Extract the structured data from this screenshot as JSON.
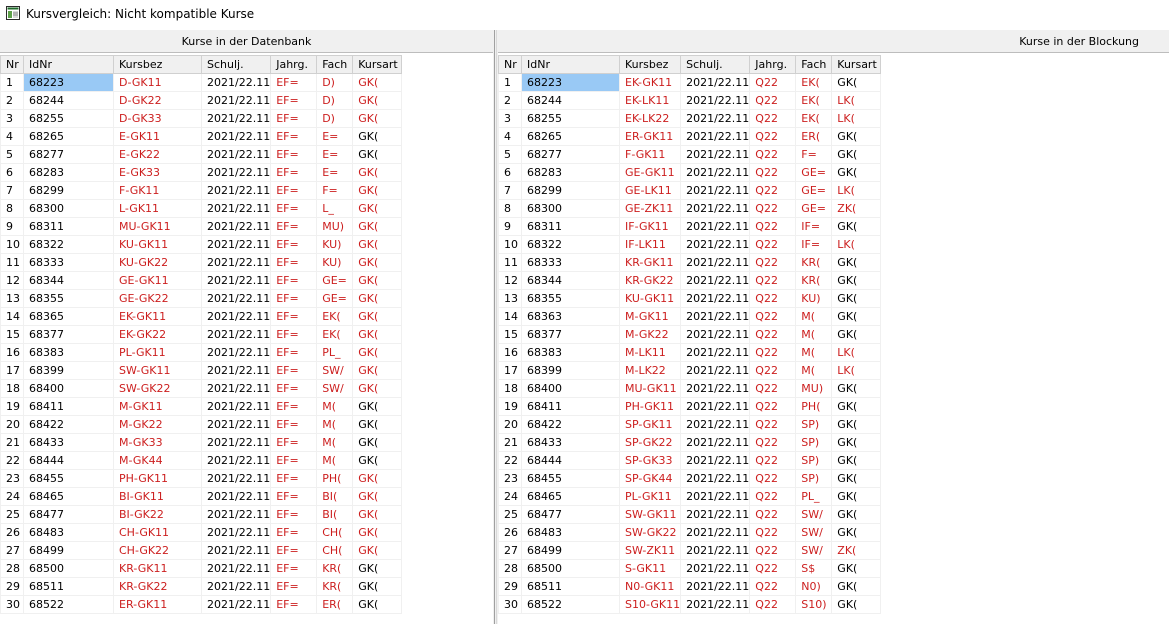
{
  "window": {
    "title": "Kursvergleich: Nicht kompatible Kurse",
    "icon": "app-window-icon"
  },
  "colors": {
    "mismatch": "#cc1e1e",
    "selection": "#99c9f5",
    "header_bg": "#f0f0f0"
  },
  "left": {
    "header": "Kurse in der Datenbank",
    "columns": [
      "Nr",
      "IdNr",
      "Kursbez",
      "Schulj.",
      "Jahrg.",
      "Fach",
      "Kursart"
    ],
    "rows": [
      [
        "1",
        "68223",
        "D-GK11",
        "2021/22.11",
        "EF=",
        "D)",
        "GK("
      ],
      [
        "2",
        "68244",
        "D-GK22",
        "2021/22.11",
        "EF=",
        "D)",
        "GK("
      ],
      [
        "3",
        "68255",
        "D-GK33",
        "2021/22.11",
        "EF=",
        "D)",
        "GK("
      ],
      [
        "4",
        "68265",
        "E-GK11",
        "2021/22.11",
        "EF=",
        "E=",
        "GK("
      ],
      [
        "5",
        "68277",
        "E-GK22",
        "2021/22.11",
        "EF=",
        "E=",
        "GK("
      ],
      [
        "6",
        "68283",
        "E-GK33",
        "2021/22.11",
        "EF=",
        "E=",
        "GK("
      ],
      [
        "7",
        "68299",
        "F-GK11",
        "2021/22.11",
        "EF=",
        "F=",
        "GK("
      ],
      [
        "8",
        "68300",
        "L-GK11",
        "2021/22.11",
        "EF=",
        "L_",
        "GK("
      ],
      [
        "9",
        "68311",
        "MU-GK11",
        "2021/22.11",
        "EF=",
        "MU)",
        "GK("
      ],
      [
        "10",
        "68322",
        "KU-GK11",
        "2021/22.11",
        "EF=",
        "KU)",
        "GK("
      ],
      [
        "11",
        "68333",
        "KU-GK22",
        "2021/22.11",
        "EF=",
        "KU)",
        "GK("
      ],
      [
        "12",
        "68344",
        "GE-GK11",
        "2021/22.11",
        "EF=",
        "GE=",
        "GK("
      ],
      [
        "13",
        "68355",
        "GE-GK22",
        "2021/22.11",
        "EF=",
        "GE=",
        "GK("
      ],
      [
        "14",
        "68365",
        "EK-GK11",
        "2021/22.11",
        "EF=",
        "EK(",
        "GK("
      ],
      [
        "15",
        "68377",
        "EK-GK22",
        "2021/22.11",
        "EF=",
        "EK(",
        "GK("
      ],
      [
        "16",
        "68383",
        "PL-GK11",
        "2021/22.11",
        "EF=",
        "PL_",
        "GK("
      ],
      [
        "17",
        "68399",
        "SW-GK11",
        "2021/22.11",
        "EF=",
        "SW/",
        "GK("
      ],
      [
        "18",
        "68400",
        "SW-GK22",
        "2021/22.11",
        "EF=",
        "SW/",
        "GK("
      ],
      [
        "19",
        "68411",
        "M-GK11",
        "2021/22.11",
        "EF=",
        "M(",
        "GK("
      ],
      [
        "20",
        "68422",
        "M-GK22",
        "2021/22.11",
        "EF=",
        "M(",
        "GK("
      ],
      [
        "21",
        "68433",
        "M-GK33",
        "2021/22.11",
        "EF=",
        "M(",
        "GK("
      ],
      [
        "22",
        "68444",
        "M-GK44",
        "2021/22.11",
        "EF=",
        "M(",
        "GK("
      ],
      [
        "23",
        "68455",
        "PH-GK11",
        "2021/22.11",
        "EF=",
        "PH(",
        "GK("
      ],
      [
        "24",
        "68465",
        "BI-GK11",
        "2021/22.11",
        "EF=",
        "BI(",
        "GK("
      ],
      [
        "25",
        "68477",
        "BI-GK22",
        "2021/22.11",
        "EF=",
        "BI(",
        "GK("
      ],
      [
        "26",
        "68483",
        "CH-GK11",
        "2021/22.11",
        "EF=",
        "CH(",
        "GK("
      ],
      [
        "27",
        "68499",
        "CH-GK22",
        "2021/22.11",
        "EF=",
        "CH(",
        "GK("
      ],
      [
        "28",
        "68500",
        "KR-GK11",
        "2021/22.11",
        "EF=",
        "KR(",
        "GK("
      ],
      [
        "29",
        "68511",
        "KR-GK22",
        "2021/22.11",
        "EF=",
        "KR(",
        "GK("
      ],
      [
        "30",
        "68522",
        "ER-GK11",
        "2021/22.11",
        "EF=",
        "ER(",
        "GK("
      ]
    ]
  },
  "right": {
    "header": "Kurse in der Blockung",
    "columns": [
      "Nr",
      "IdNr",
      "Kursbez",
      "Schulj.",
      "Jahrg.",
      "Fach",
      "Kursart"
    ],
    "rows": [
      [
        "1",
        "68223",
        "EK-GK11",
        "2021/22.11",
        "Q22",
        "EK(",
        "GK("
      ],
      [
        "2",
        "68244",
        "EK-LK11",
        "2021/22.11",
        "Q22",
        "EK(",
        "LK("
      ],
      [
        "3",
        "68255",
        "EK-LK22",
        "2021/22.11",
        "Q22",
        "EK(",
        "LK("
      ],
      [
        "4",
        "68265",
        "ER-GK11",
        "2021/22.11",
        "Q22",
        "ER(",
        "GK("
      ],
      [
        "5",
        "68277",
        "F-GK11",
        "2021/22.11",
        "Q22",
        "F=",
        "GK("
      ],
      [
        "6",
        "68283",
        "GE-GK11",
        "2021/22.11",
        "Q22",
        "GE=",
        "GK("
      ],
      [
        "7",
        "68299",
        "GE-LK11",
        "2021/22.11",
        "Q22",
        "GE=",
        "LK("
      ],
      [
        "8",
        "68300",
        "GE-ZK11",
        "2021/22.11",
        "Q22",
        "GE=",
        "ZK("
      ],
      [
        "9",
        "68311",
        "IF-GK11",
        "2021/22.11",
        "Q22",
        "IF=",
        "GK("
      ],
      [
        "10",
        "68322",
        "IF-LK11",
        "2021/22.11",
        "Q22",
        "IF=",
        "LK("
      ],
      [
        "11",
        "68333",
        "KR-GK11",
        "2021/22.11",
        "Q22",
        "KR(",
        "GK("
      ],
      [
        "12",
        "68344",
        "KR-GK22",
        "2021/22.11",
        "Q22",
        "KR(",
        "GK("
      ],
      [
        "13",
        "68355",
        "KU-GK11",
        "2021/22.11",
        "Q22",
        "KU)",
        "GK("
      ],
      [
        "14",
        "68363",
        "M-GK11",
        "2021/22.11",
        "Q22",
        "M(",
        "GK("
      ],
      [
        "15",
        "68377",
        "M-GK22",
        "2021/22.11",
        "Q22",
        "M(",
        "GK("
      ],
      [
        "16",
        "68383",
        "M-LK11",
        "2021/22.11",
        "Q22",
        "M(",
        "LK("
      ],
      [
        "17",
        "68399",
        "M-LK22",
        "2021/22.11",
        "Q22",
        "M(",
        "LK("
      ],
      [
        "18",
        "68400",
        "MU-GK11",
        "2021/22.11",
        "Q22",
        "MU)",
        "GK("
      ],
      [
        "19",
        "68411",
        "PH-GK11",
        "2021/22.11",
        "Q22",
        "PH(",
        "GK("
      ],
      [
        "20",
        "68422",
        "SP-GK11",
        "2021/22.11",
        "Q22",
        "SP)",
        "GK("
      ],
      [
        "21",
        "68433",
        "SP-GK22",
        "2021/22.11",
        "Q22",
        "SP)",
        "GK("
      ],
      [
        "22",
        "68444",
        "SP-GK33",
        "2021/22.11",
        "Q22",
        "SP)",
        "GK("
      ],
      [
        "23",
        "68455",
        "SP-GK44",
        "2021/22.11",
        "Q22",
        "SP)",
        "GK("
      ],
      [
        "24",
        "68465",
        "PL-GK11",
        "2021/22.11",
        "Q22",
        "PL_",
        "GK("
      ],
      [
        "25",
        "68477",
        "SW-GK11",
        "2021/22.11",
        "Q22",
        "SW/",
        "GK("
      ],
      [
        "26",
        "68483",
        "SW-GK22",
        "2021/22.11",
        "Q22",
        "SW/",
        "GK("
      ],
      [
        "27",
        "68499",
        "SW-ZK11",
        "2021/22.11",
        "Q22",
        "SW/",
        "ZK("
      ],
      [
        "28",
        "68500",
        "S-GK11",
        "2021/22.11",
        "Q22",
        "S$",
        "GK("
      ],
      [
        "29",
        "68511",
        "N0-GK11",
        "2021/22.11",
        "Q22",
        "N0)",
        "GK("
      ],
      [
        "30",
        "68522",
        "S10-GK11",
        "2021/22.11",
        "Q22",
        "S10)",
        "GK("
      ]
    ]
  }
}
